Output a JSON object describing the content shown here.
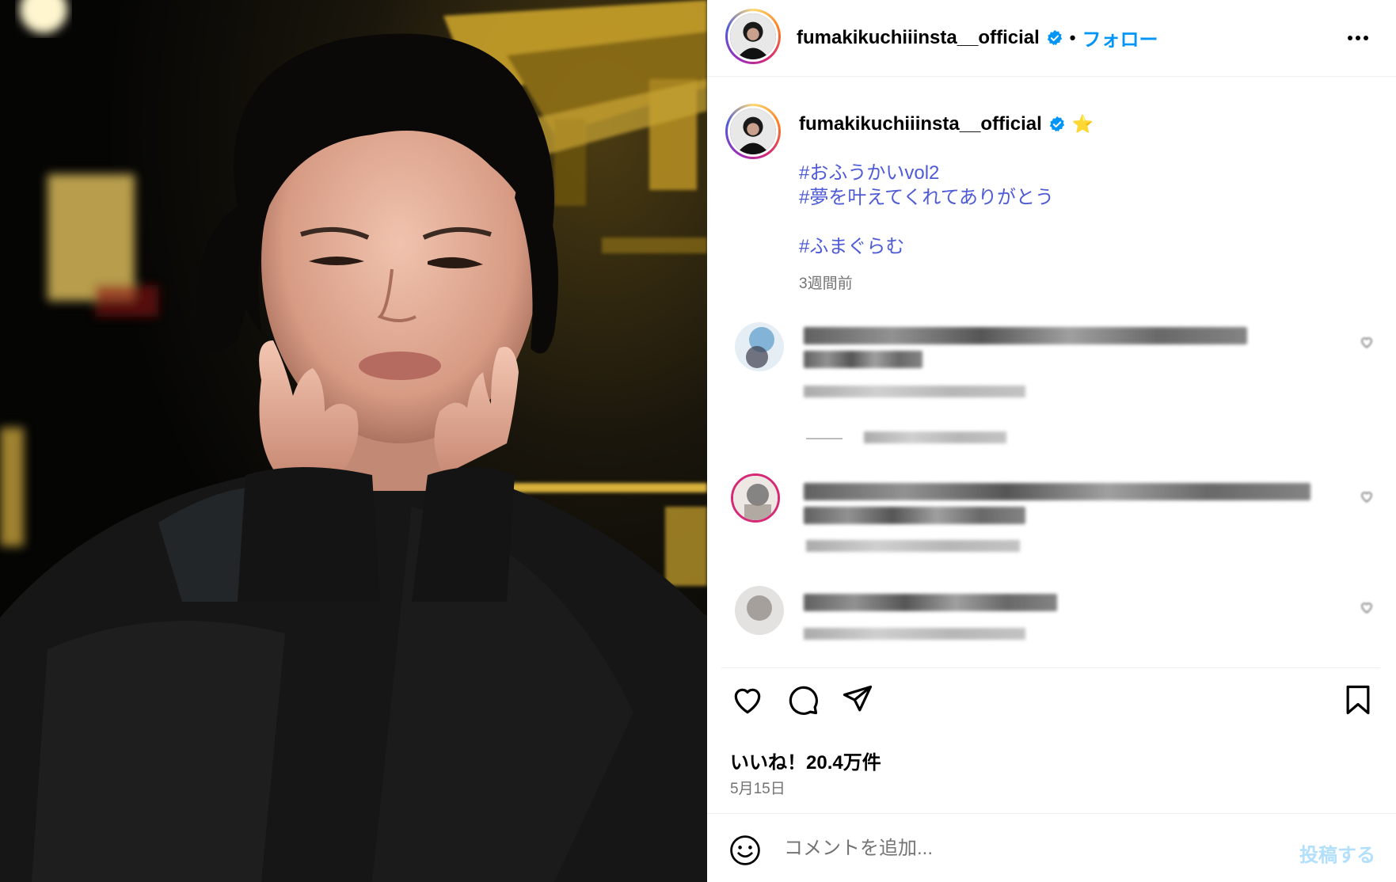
{
  "post": {
    "username": "fumakikuchiiinsta__official",
    "verified_icon": "verified-badge-icon",
    "follow_label": "フォロー",
    "separator": "•",
    "more_icon": "more-options-icon"
  },
  "caption": {
    "username": "fumakikuchiiinsta__official",
    "emoji": "⭐",
    "hashtags": [
      "#おふうかいvol2",
      "#夢を叶えてくれてありがとう",
      "#ふまぐらむ"
    ],
    "time_ago": "3週間前"
  },
  "comments": [
    {
      "author_hidden": true,
      "text_hidden": true,
      "reply_toggle_hidden": true
    },
    {
      "author_hidden": true,
      "text_hidden": true
    },
    {
      "author_hidden": true,
      "text_hidden": true
    }
  ],
  "actions": {
    "like_icon": "heart-icon",
    "comment_icon": "comment-bubble-icon",
    "share_icon": "send-icon",
    "save_icon": "bookmark-icon"
  },
  "stats": {
    "likes": "いいね！20.4万件",
    "date": "5月15日"
  },
  "comment_box": {
    "emoji_icon": "smiley-icon",
    "placeholder": "コメントを追加...",
    "post_label": "投稿する"
  },
  "colors": {
    "link_blue": "#0095f6",
    "hashtag": "#4f5bd5",
    "muted": "#737373",
    "post_disabled": "#b2dffc"
  }
}
